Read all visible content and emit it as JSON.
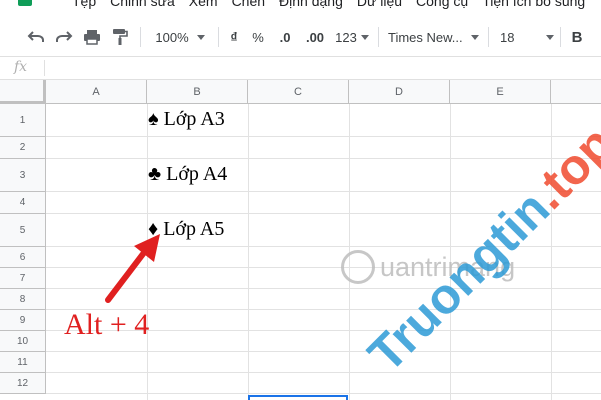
{
  "menu": {
    "items": [
      "Tệp",
      "Chỉnh sửa",
      "Xem",
      "Chèn",
      "Định dạng",
      "Dữ liệu",
      "Công cụ",
      "Tiện ích bổ sung"
    ]
  },
  "toolbar": {
    "zoom": "100%",
    "currency": "₫",
    "percent": "%",
    "decimal_decrease": ".0",
    "decimal_increase": ".00",
    "more_formats": "123",
    "font": "Times New...",
    "font_size": "18",
    "bold": "B",
    "icons": [
      "undo-icon",
      "redo-icon",
      "print-icon",
      "paint-format-icon"
    ]
  },
  "formula_bar": {
    "label": "fx",
    "value": ""
  },
  "columns": [
    "A",
    "B",
    "C",
    "D",
    "E"
  ],
  "rows": [
    "1",
    "2",
    "3",
    "4",
    "5",
    "6",
    "7",
    "8",
    "9",
    "10",
    "11",
    "12"
  ],
  "cells": {
    "B1": "♠ Lớp A3",
    "B3": "♣ Lớp A4",
    "B5": "♦ Lớp A5"
  },
  "annotation": {
    "text": "Alt + 4",
    "color": "#e02020"
  },
  "watermark": {
    "brand": "Truongtin",
    "tld": ".top",
    "sub": "uantrimang"
  },
  "colors": {
    "accent": "#1a73e8",
    "sheets_green": "#0f9d58",
    "watermark_blue": "#2d9bd6",
    "watermark_red": "#f04b2e"
  }
}
